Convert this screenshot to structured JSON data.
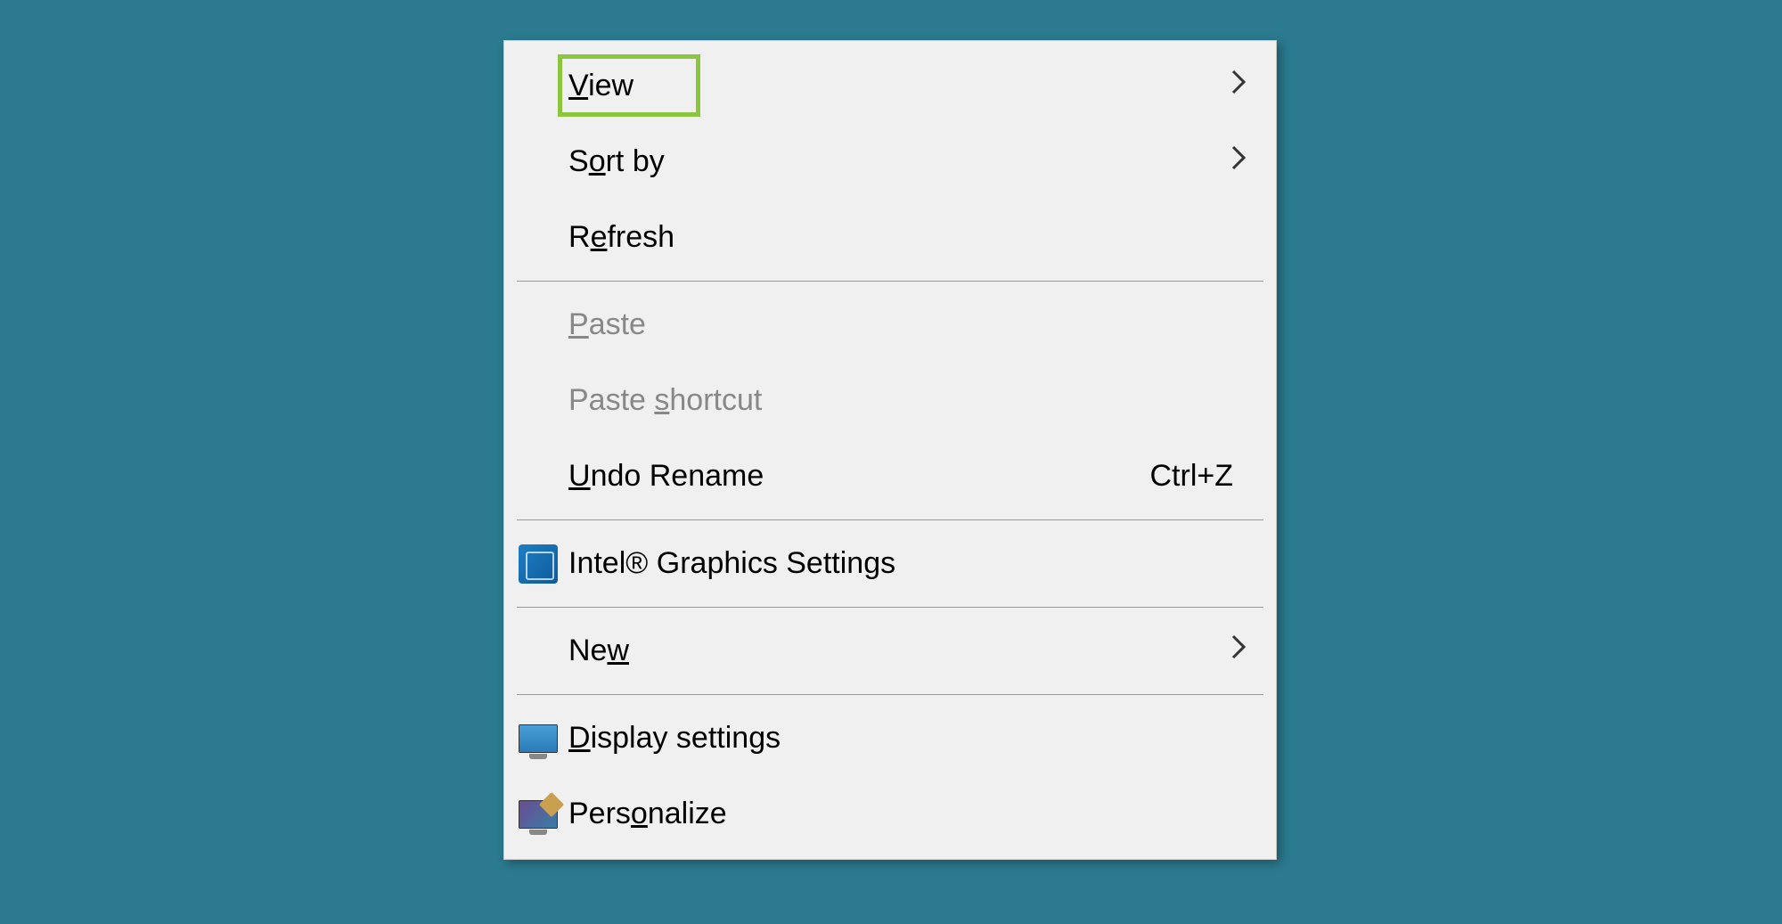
{
  "menu": {
    "items": [
      {
        "label_pre": "",
        "label_u": "V",
        "label_post": "iew",
        "has_arrow": true,
        "highlighted": true
      },
      {
        "label_pre": "S",
        "label_u": "o",
        "label_post": "rt by",
        "has_arrow": true
      },
      {
        "label_pre": "R",
        "label_u": "e",
        "label_post": "fresh"
      },
      {
        "label_pre": "",
        "label_u": "P",
        "label_post": "aste",
        "disabled": true
      },
      {
        "label_pre": "Paste ",
        "label_u": "s",
        "label_post": "hortcut",
        "disabled": true
      },
      {
        "label_pre": "",
        "label_u": "U",
        "label_post": "ndo Rename",
        "shortcut": "Ctrl+Z"
      },
      {
        "label_pre": "Intel® Graphics Settings",
        "label_u": "",
        "label_post": "",
        "icon": "intel"
      },
      {
        "label_pre": "Ne",
        "label_u": "w",
        "label_post": "",
        "has_arrow": true
      },
      {
        "label_pre": "",
        "label_u": "D",
        "label_post": "isplay settings",
        "icon": "display"
      },
      {
        "label_pre": "Pers",
        "label_u": "o",
        "label_post": "nalize",
        "icon": "personalize"
      }
    ]
  }
}
